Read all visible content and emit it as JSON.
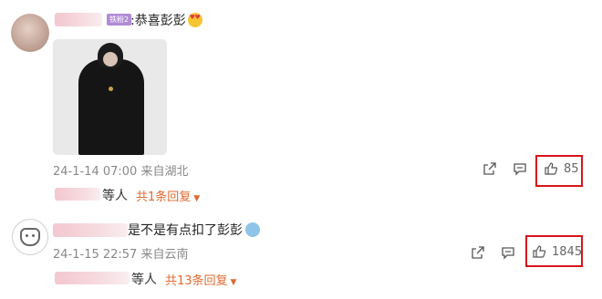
{
  "comments": [
    {
      "text": ":恭喜彭彭",
      "badge": "铁粉2",
      "timestamp": "24-1-14 07:00 来自湖北",
      "reply_users_suffix": "等人",
      "reply_count_label": "共1条回复",
      "likes": "85",
      "emoji": "smiling-face-with-heart-eyes"
    },
    {
      "text": "是不是有点扣了彭彭",
      "timestamp": "24-1-15 22:57 来自云南",
      "reply_users_suffix": "等人",
      "reply_count_label": "共13条回复",
      "likes": "1845",
      "emoji": "crying-face"
    }
  ],
  "colors": {
    "highlight_box": "#d9141c",
    "reply_link": "#e06a30"
  }
}
